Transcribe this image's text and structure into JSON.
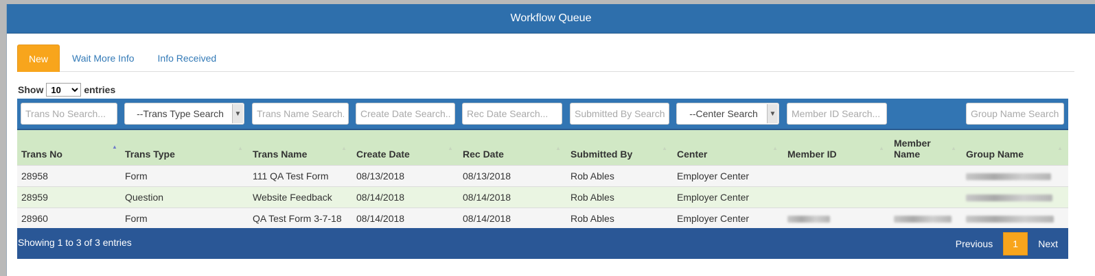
{
  "header": {
    "title": "Workflow Queue"
  },
  "tabs": [
    {
      "label": "New",
      "active": true
    },
    {
      "label": "Wait More Info",
      "active": false
    },
    {
      "label": "Info Received",
      "active": false
    }
  ],
  "length": {
    "prefix": "Show",
    "value": "10",
    "suffix": "entries"
  },
  "filters": {
    "trans_no": "Trans No Search...",
    "trans_type": "--Trans Type Search",
    "trans_name": "Trans Name Search...",
    "create_date": "Create Date Search...",
    "rec_date": "Rec Date Search...",
    "submitted_by": "Submitted By Search...",
    "center": "--Center Search",
    "member_id": "Member ID Search...",
    "group_name": "Group Name Search..."
  },
  "columns": [
    "Trans No",
    "Trans Type",
    "Trans Name",
    "Create Date",
    "Rec Date",
    "Submitted By",
    "Center",
    "Member ID",
    "Member Name",
    "Group Name"
  ],
  "rows": [
    {
      "trans_no": "28958",
      "trans_type": "Form",
      "trans_name": "111 QA Test Form",
      "create_date": "08/13/2018",
      "rec_date": "08/13/2018",
      "submitted_by": "Rob Ables",
      "center": "Employer Center"
    },
    {
      "trans_no": "28959",
      "trans_type": "Question",
      "trans_name": "Website Feedback",
      "create_date": "08/14/2018",
      "rec_date": "08/14/2018",
      "submitted_by": "Rob Ables",
      "center": "Employer Center"
    },
    {
      "trans_no": "28960",
      "trans_type": "Form",
      "trans_name": "QA Test Form 3-7-18",
      "create_date": "08/14/2018",
      "rec_date": "08/14/2018",
      "submitted_by": "Rob Ables",
      "center": "Employer Center"
    }
  ],
  "footer": {
    "info": "Showing 1 to 3 of 3 entries",
    "previous": "Previous",
    "current_page": "1",
    "next": "Next"
  },
  "colors": {
    "header": "#2e6fac",
    "accent_orange": "#f8a51c",
    "filter_bar": "#3275b3",
    "table_header": "#d1e8c5",
    "footer": "#2a5796"
  }
}
